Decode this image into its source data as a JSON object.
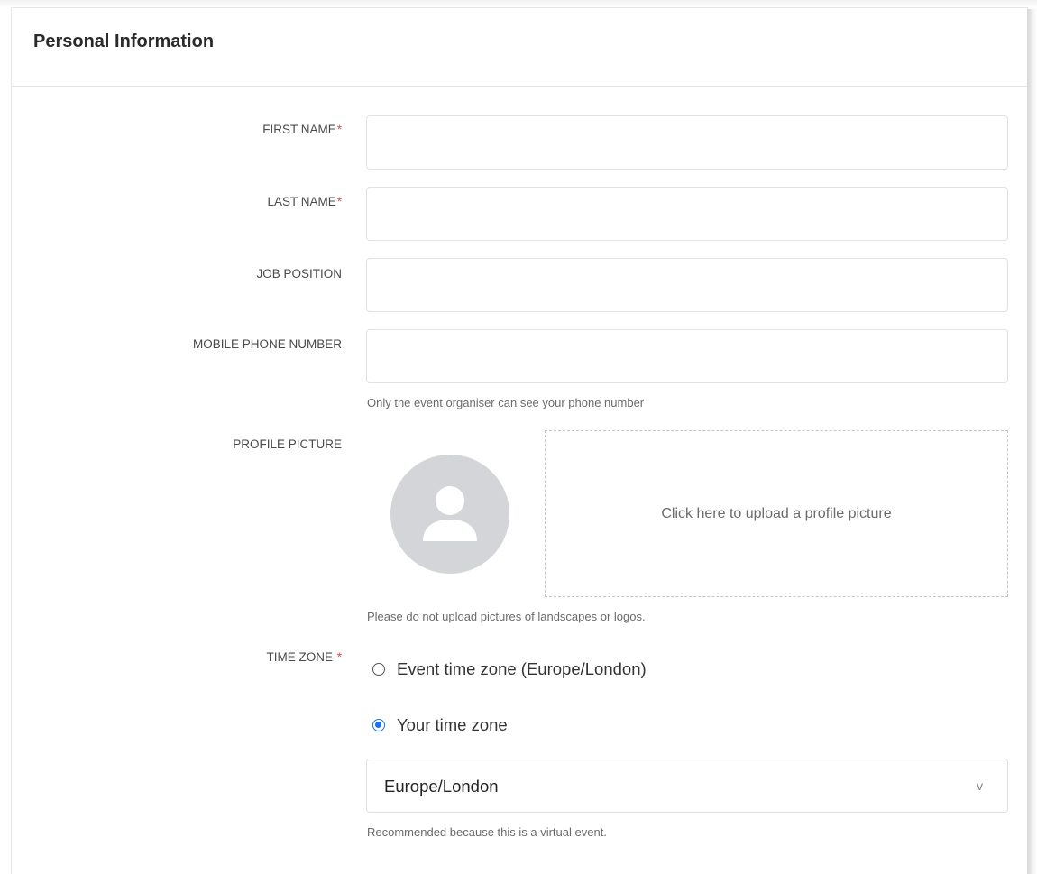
{
  "header": {
    "title": "Personal Information"
  },
  "fields": {
    "first_name": {
      "label": "FIRST NAME",
      "required_mark": "*",
      "value": ""
    },
    "last_name": {
      "label": "LAST NAME",
      "required_mark": "*",
      "value": ""
    },
    "job_position": {
      "label": "JOB POSITION",
      "value": ""
    },
    "mobile_phone": {
      "label": "MOBILE PHONE NUMBER",
      "value": "",
      "help": "Only the event organiser can see your phone number"
    },
    "profile_picture": {
      "label": "PROFILE PICTURE",
      "upload_text": "Click here to upload a profile picture",
      "help": "Please do not upload pictures of landscapes or logos.",
      "placeholder_icon": "user-silhouette-icon"
    },
    "time_zone": {
      "label": "TIME ZONE",
      "required_mark": "*",
      "options": [
        {
          "label": "Event time zone (Europe/London)",
          "checked": false
        },
        {
          "label": "Your time zone",
          "checked": true
        }
      ],
      "select_value": "Europe/London",
      "select_arrow": "v",
      "help": "Recommended because this is a virtual event."
    }
  },
  "colors": {
    "required": "#d9534f",
    "radio_selected": "#1a73e8",
    "avatar_bg": "#d3d5d8"
  }
}
